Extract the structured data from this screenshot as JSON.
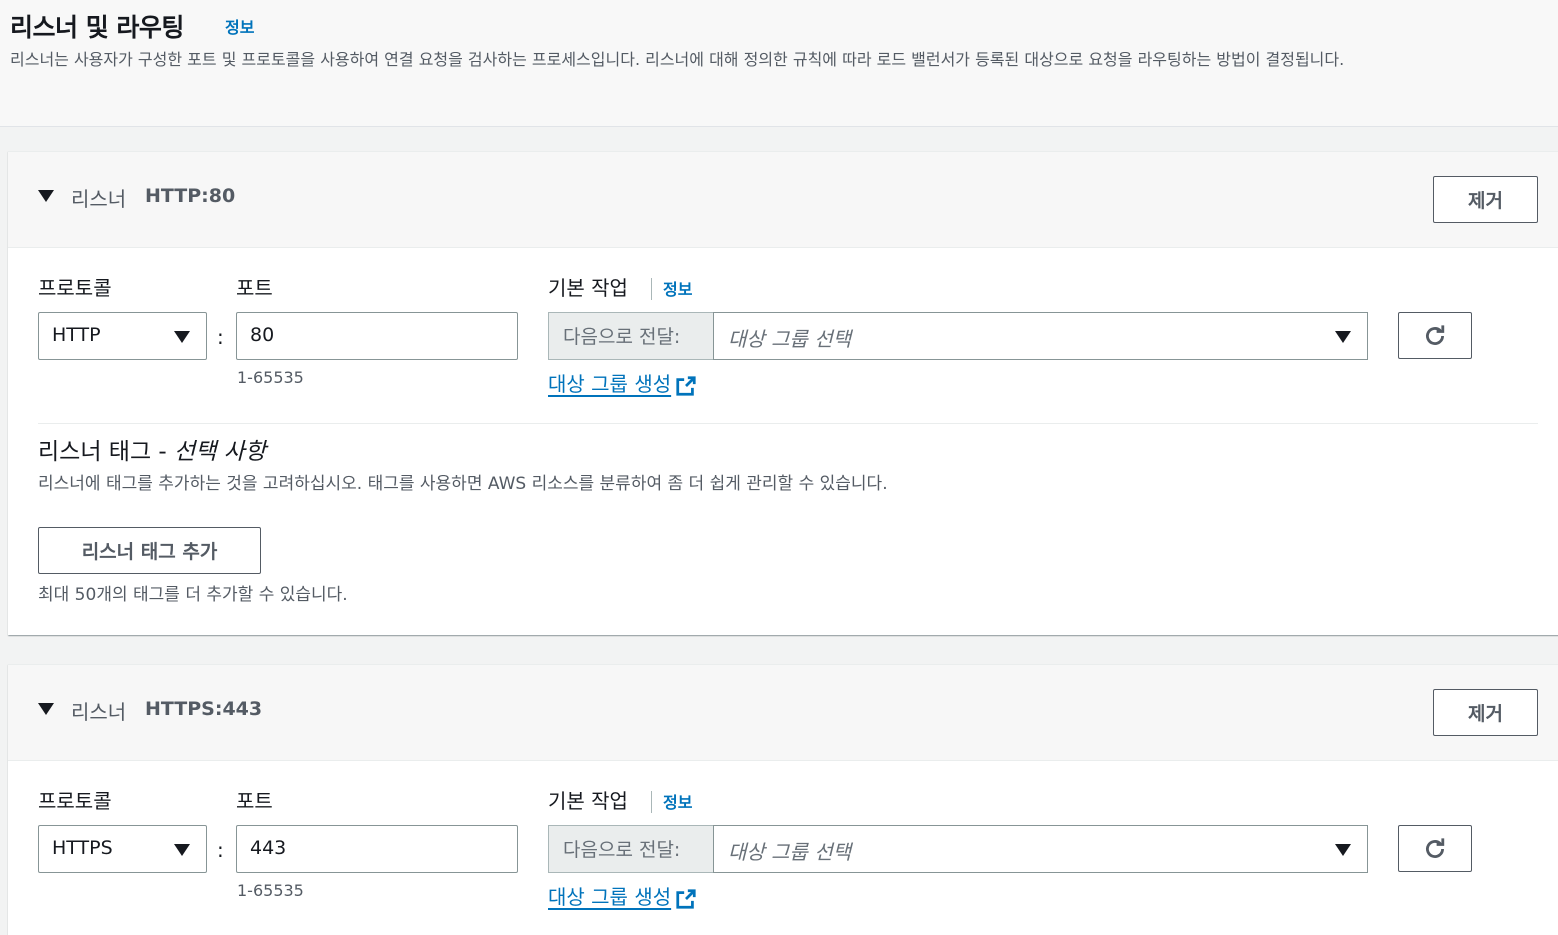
{
  "header": {
    "title": "리스너 및 라우팅",
    "info": "정보",
    "description": "리스너는 사용자가 구성한 포트 및 프로토콜을 사용하여 연결 요청을 검사하는 프로세스입니다. 리스너에 대해 정의한 규칙에 따라 로드 밸런서가 등록된 대상으로 요청을 라우팅하는 방법이 결정됩니다."
  },
  "listeners": [
    {
      "listener_word": "리스너",
      "id": "HTTP:80",
      "remove_label": "제거",
      "protocol_label": "프로토콜",
      "protocol_value": "HTTP",
      "port_label": "포트",
      "port_value": "80",
      "port_hint": "1-65535",
      "default_action_label": "기본 작업",
      "info": "정보",
      "forward_addon": "다음으로 전달:",
      "target_group_placeholder": "대상 그룹 선택",
      "create_target_group": "대상 그룹 생성",
      "tags_title_main": "리스너 태그 - ",
      "tags_title_optional": "선택 사항",
      "tags_desc": "리스너에 태그를 추가하는 것을 고려하십시오. 태그를 사용하면 AWS 리소스를 분류하여 좀 더 쉽게 관리할 수 있습니다.",
      "add_tag_label": "리스너 태그 추가",
      "tags_limit": "최대 50개의 태그를 더 추가할 수 있습니다."
    },
    {
      "listener_word": "리스너",
      "id": "HTTPS:443",
      "remove_label": "제거",
      "protocol_label": "프로토콜",
      "protocol_value": "HTTPS",
      "port_label": "포트",
      "port_value": "443",
      "port_hint": "1-65535",
      "default_action_label": "기본 작업",
      "info": "정보",
      "forward_addon": "다음으로 전달:",
      "target_group_placeholder": "대상 그룹 선택",
      "create_target_group": "대상 그룹 생성"
    }
  ],
  "colon": ":",
  "icons": {
    "expand": "caret-down-icon",
    "dropdown": "chevron-down-icon",
    "refresh": "refresh-icon",
    "external": "external-link-icon"
  },
  "colors": {
    "link": "#0073bb",
    "text": "#16191f",
    "secondary_text": "#545b64"
  }
}
